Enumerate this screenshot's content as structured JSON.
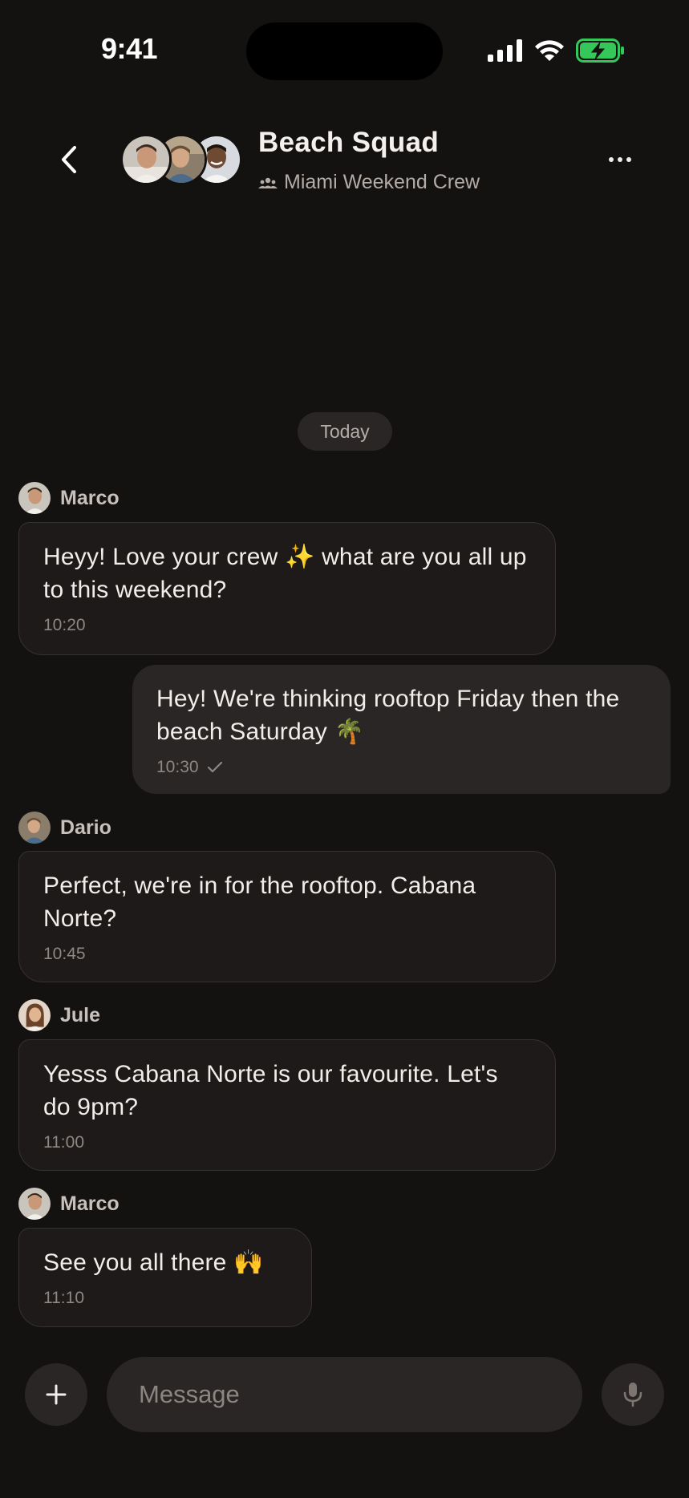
{
  "status_bar": {
    "time": "9:41"
  },
  "header": {
    "back_icon": "chevron-left-icon",
    "title": "Beach Squad",
    "subtitle": "Miami Weekend Crew",
    "subtitle_icon": "group-icon",
    "more_icon": "more-horizontal-icon"
  },
  "date_separator": "Today",
  "messages": [
    {
      "sender": "Marco",
      "text": "Heyy! Love your crew ✨  what are you all up to this weekend?",
      "time": "10:20",
      "outgoing": false
    },
    {
      "sender": "",
      "text": "Hey! We're thinking rooftop Friday then the beach Saturday 🌴",
      "time": "10:30",
      "outgoing": true,
      "status_icon": "check-icon"
    },
    {
      "sender": "Dario",
      "text": "Perfect, we're in for the rooftop. Cabana Norte?",
      "time": "10:45",
      "outgoing": false
    },
    {
      "sender": "Jule",
      "text": "Yesss Cabana Norte is our favourite. Let's do 9pm?",
      "time": "11:00",
      "outgoing": false
    },
    {
      "sender": "Marco",
      "text": "See you all there 🙌",
      "time": "11:10",
      "outgoing": false
    }
  ],
  "composer": {
    "placeholder": "Message",
    "value": "",
    "attach_icon": "plus-icon",
    "mic_icon": "microphone-icon"
  },
  "colors": {
    "background": "#141111",
    "incoming_bubble": "#1d1a19",
    "outgoing_bubble": "#2a2625",
    "battery_fill": "#34c759"
  }
}
